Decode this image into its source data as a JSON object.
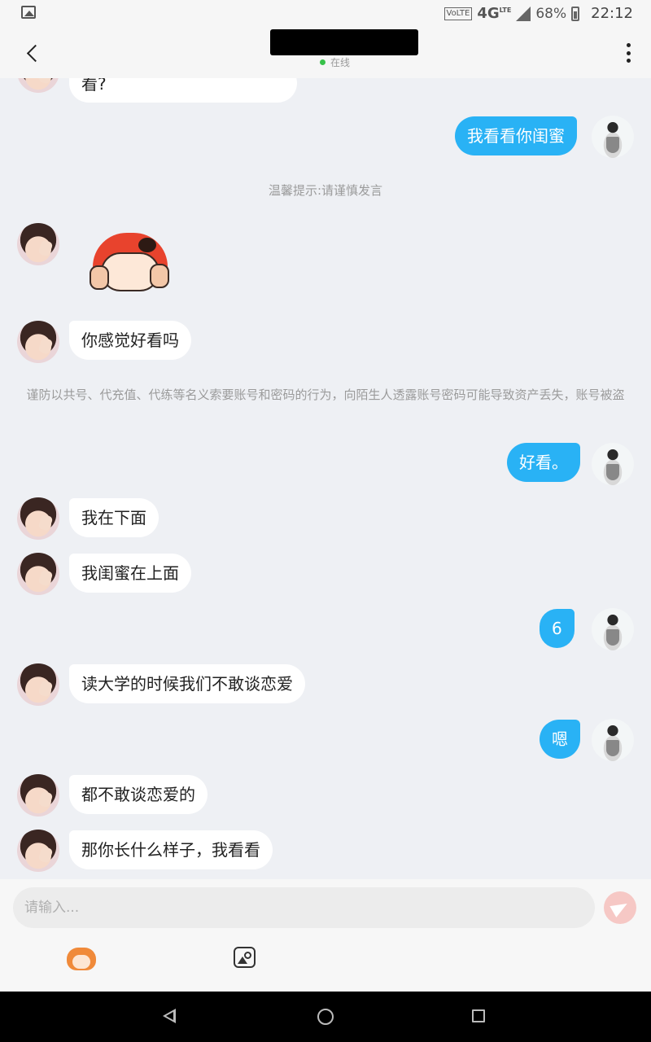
{
  "status_bar": {
    "volte": "VoLTE",
    "network": "4G",
    "network_sup": "LTE",
    "battery": "68%",
    "time": "22:12"
  },
  "header": {
    "status": "在线"
  },
  "messages": [
    {
      "side": "left",
      "text": "看?"
    },
    {
      "side": "right",
      "text": "我看看你闺蜜"
    },
    {
      "side": "system",
      "text": "温馨提示:请谨慎发言"
    },
    {
      "side": "left",
      "type": "sticker",
      "sticker": "sticker-girl-peek"
    },
    {
      "side": "left",
      "text": "你感觉好看吗"
    },
    {
      "side": "system",
      "text": "谨防以共号、代充值、代练等名义索要账号和密码的行为，向陌生人透露账号密码可能导致资产丢失，账号被盗"
    },
    {
      "side": "right",
      "text": "好看。"
    },
    {
      "side": "left",
      "text": "我在下面"
    },
    {
      "side": "left",
      "text": "我闺蜜在上面"
    },
    {
      "side": "right",
      "text": "6"
    },
    {
      "side": "left",
      "text": "读大学的时候我们不敢谈恋爱"
    },
    {
      "side": "right",
      "text": "嗯"
    },
    {
      "side": "left",
      "text": "都不敢谈恋爱的"
    },
    {
      "side": "left",
      "text": "那你长什么样子，我看看"
    }
  ],
  "composer": {
    "placeholder": "请输入...",
    "value": ""
  },
  "icons": {
    "back": "chevron-left-icon",
    "more": "more-vertical-icon",
    "send": "send-icon",
    "emoji": "emoji-sticker-icon",
    "image": "image-icon"
  },
  "colors": {
    "outgoing_bubble": "#29b2f5",
    "incoming_bubble": "#ffffff",
    "background": "#eef0f4",
    "online_dot": "#38c24a",
    "send_button": "#f6c8c5"
  }
}
